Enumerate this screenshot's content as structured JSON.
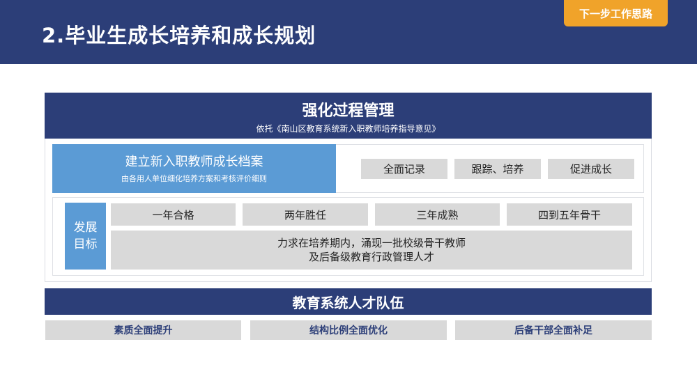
{
  "header": {
    "title": "2.毕业生成长培养和成长规划",
    "badge": "下一步工作思路"
  },
  "process": {
    "title": "强化过程管理",
    "subtitle": "依托《南山区教育系统新入职教师培养指导意见》"
  },
  "archive": {
    "title": "建立新入职教师成长档案",
    "subtitle": "由各用人单位细化培养方案和考核评价细则",
    "actions": [
      "全面记录",
      "跟踪、培养",
      "促进成长"
    ]
  },
  "goals": {
    "label_line1": "发展",
    "label_line2": "目标",
    "stages": [
      "一年合格",
      "两年胜任",
      "三年成熟",
      "四到五年骨干"
    ],
    "desc_line1": "力求在培养期内，涌现一批校级骨干教师",
    "desc_line2": "及后备级教育行政管理人才"
  },
  "talent": {
    "title": "教育系统人才队伍",
    "items": [
      "素质全面提升",
      "结构比例全面优化",
      "后备干部全面补足"
    ]
  },
  "colors": {
    "navy": "#2c3e78",
    "orange": "#f0a32a",
    "blue": "#5b9bd5",
    "gray": "#d9d9d9"
  }
}
